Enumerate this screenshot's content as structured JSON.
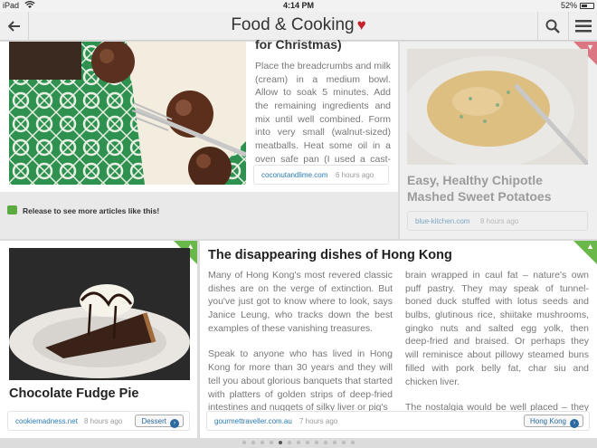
{
  "status": {
    "carrier": "iPad",
    "time": "4:14 PM",
    "battery": "52%",
    "battery_level": 0.52
  },
  "header": {
    "title": "Food & Cooking"
  },
  "card_meatballs": {
    "heading_tail": "for Christmas)",
    "text": "Place the breadcrumbs and milk (cream) in a medium bowl. Allow to soak 5 minutes. Add the remaining ingredients and mix until well combined. Form into very small (walnut-sized) meatballs. Heat some oil in a oven safe pan (I used a cast-iron skillet). ...",
    "source": "coconutandlime.com",
    "time": "6 hours ago"
  },
  "card_potatoes": {
    "title": "Easy, Healthy Chipotle Mashed Sweet Potatoes",
    "source": "blue-kitchen.com",
    "time": "8 hours ago"
  },
  "release_hint": "Release to see more articles like this!",
  "card_pie": {
    "title": "Chocolate Fudge Pie",
    "source": "cookiemadness.net",
    "time": "8 hours ago",
    "tag": "Dessert"
  },
  "card_hongkong": {
    "title": "The disappearing dishes of Hong Kong",
    "col1": "Many of Hong Kong's most revered classic dishes are on the verge of extinction. But you've just got to know where to look, says Janice Leung, who tracks down the best examples of these vanishing treasures.",
    "col1b": "Speak to anyone who has lived in Hong Kong for more than 30 years and they will tell you about glorious banquets that started with platters of golden strips of deep-fried intestines and nuggets of silky liver or pig's",
    "col2": "brain wrapped in caul fat – nature's own puff pastry. They may speak of tunnel-boned duck stuffed with lotus seeds and bulbs, glutinous rice, shiitake mushrooms, gingko nuts and salted egg yolk, then deep-fried and braised. Or perhaps they will reminisce about pillowy steamed buns filled with pork belly fat, char siu and chicken liver.",
    "col2b": "The nostalgia would be well placed – they would be recalling some of Hong Kong's ...",
    "source": "gourmettraveller.com.au",
    "time": "7 hours ago",
    "tag": "Hong Kong"
  },
  "pagination": {
    "total": 13,
    "current": 5
  }
}
